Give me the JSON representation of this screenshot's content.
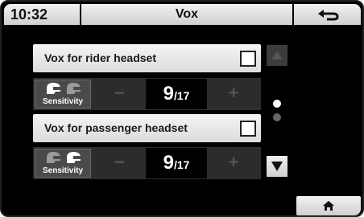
{
  "header": {
    "time": "10:32",
    "title": "Vox"
  },
  "settings": [
    {
      "label": "Vox for rider headset",
      "checked": false,
      "sensitivity": {
        "label": "Sensitivity",
        "value": "9",
        "max": "/17",
        "minus": "−",
        "plus": "+"
      }
    },
    {
      "label": "Vox for passenger headset",
      "checked": false,
      "sensitivity": {
        "label": "Sensitivity",
        "value": "9",
        "max": "/17",
        "minus": "−",
        "plus": "+"
      }
    }
  ],
  "page_indicator": {
    "current": 1,
    "total": 2
  },
  "icons": {
    "back": "back-arrow-icon",
    "home": "home-icon",
    "scroll_up": "triangle-up-icon",
    "scroll_down": "triangle-down-icon",
    "helmets": "helmet-icon"
  },
  "colors": {
    "background": "#000000",
    "button_light": "#e6e6e6",
    "row_dark": "#2e2e2e"
  }
}
